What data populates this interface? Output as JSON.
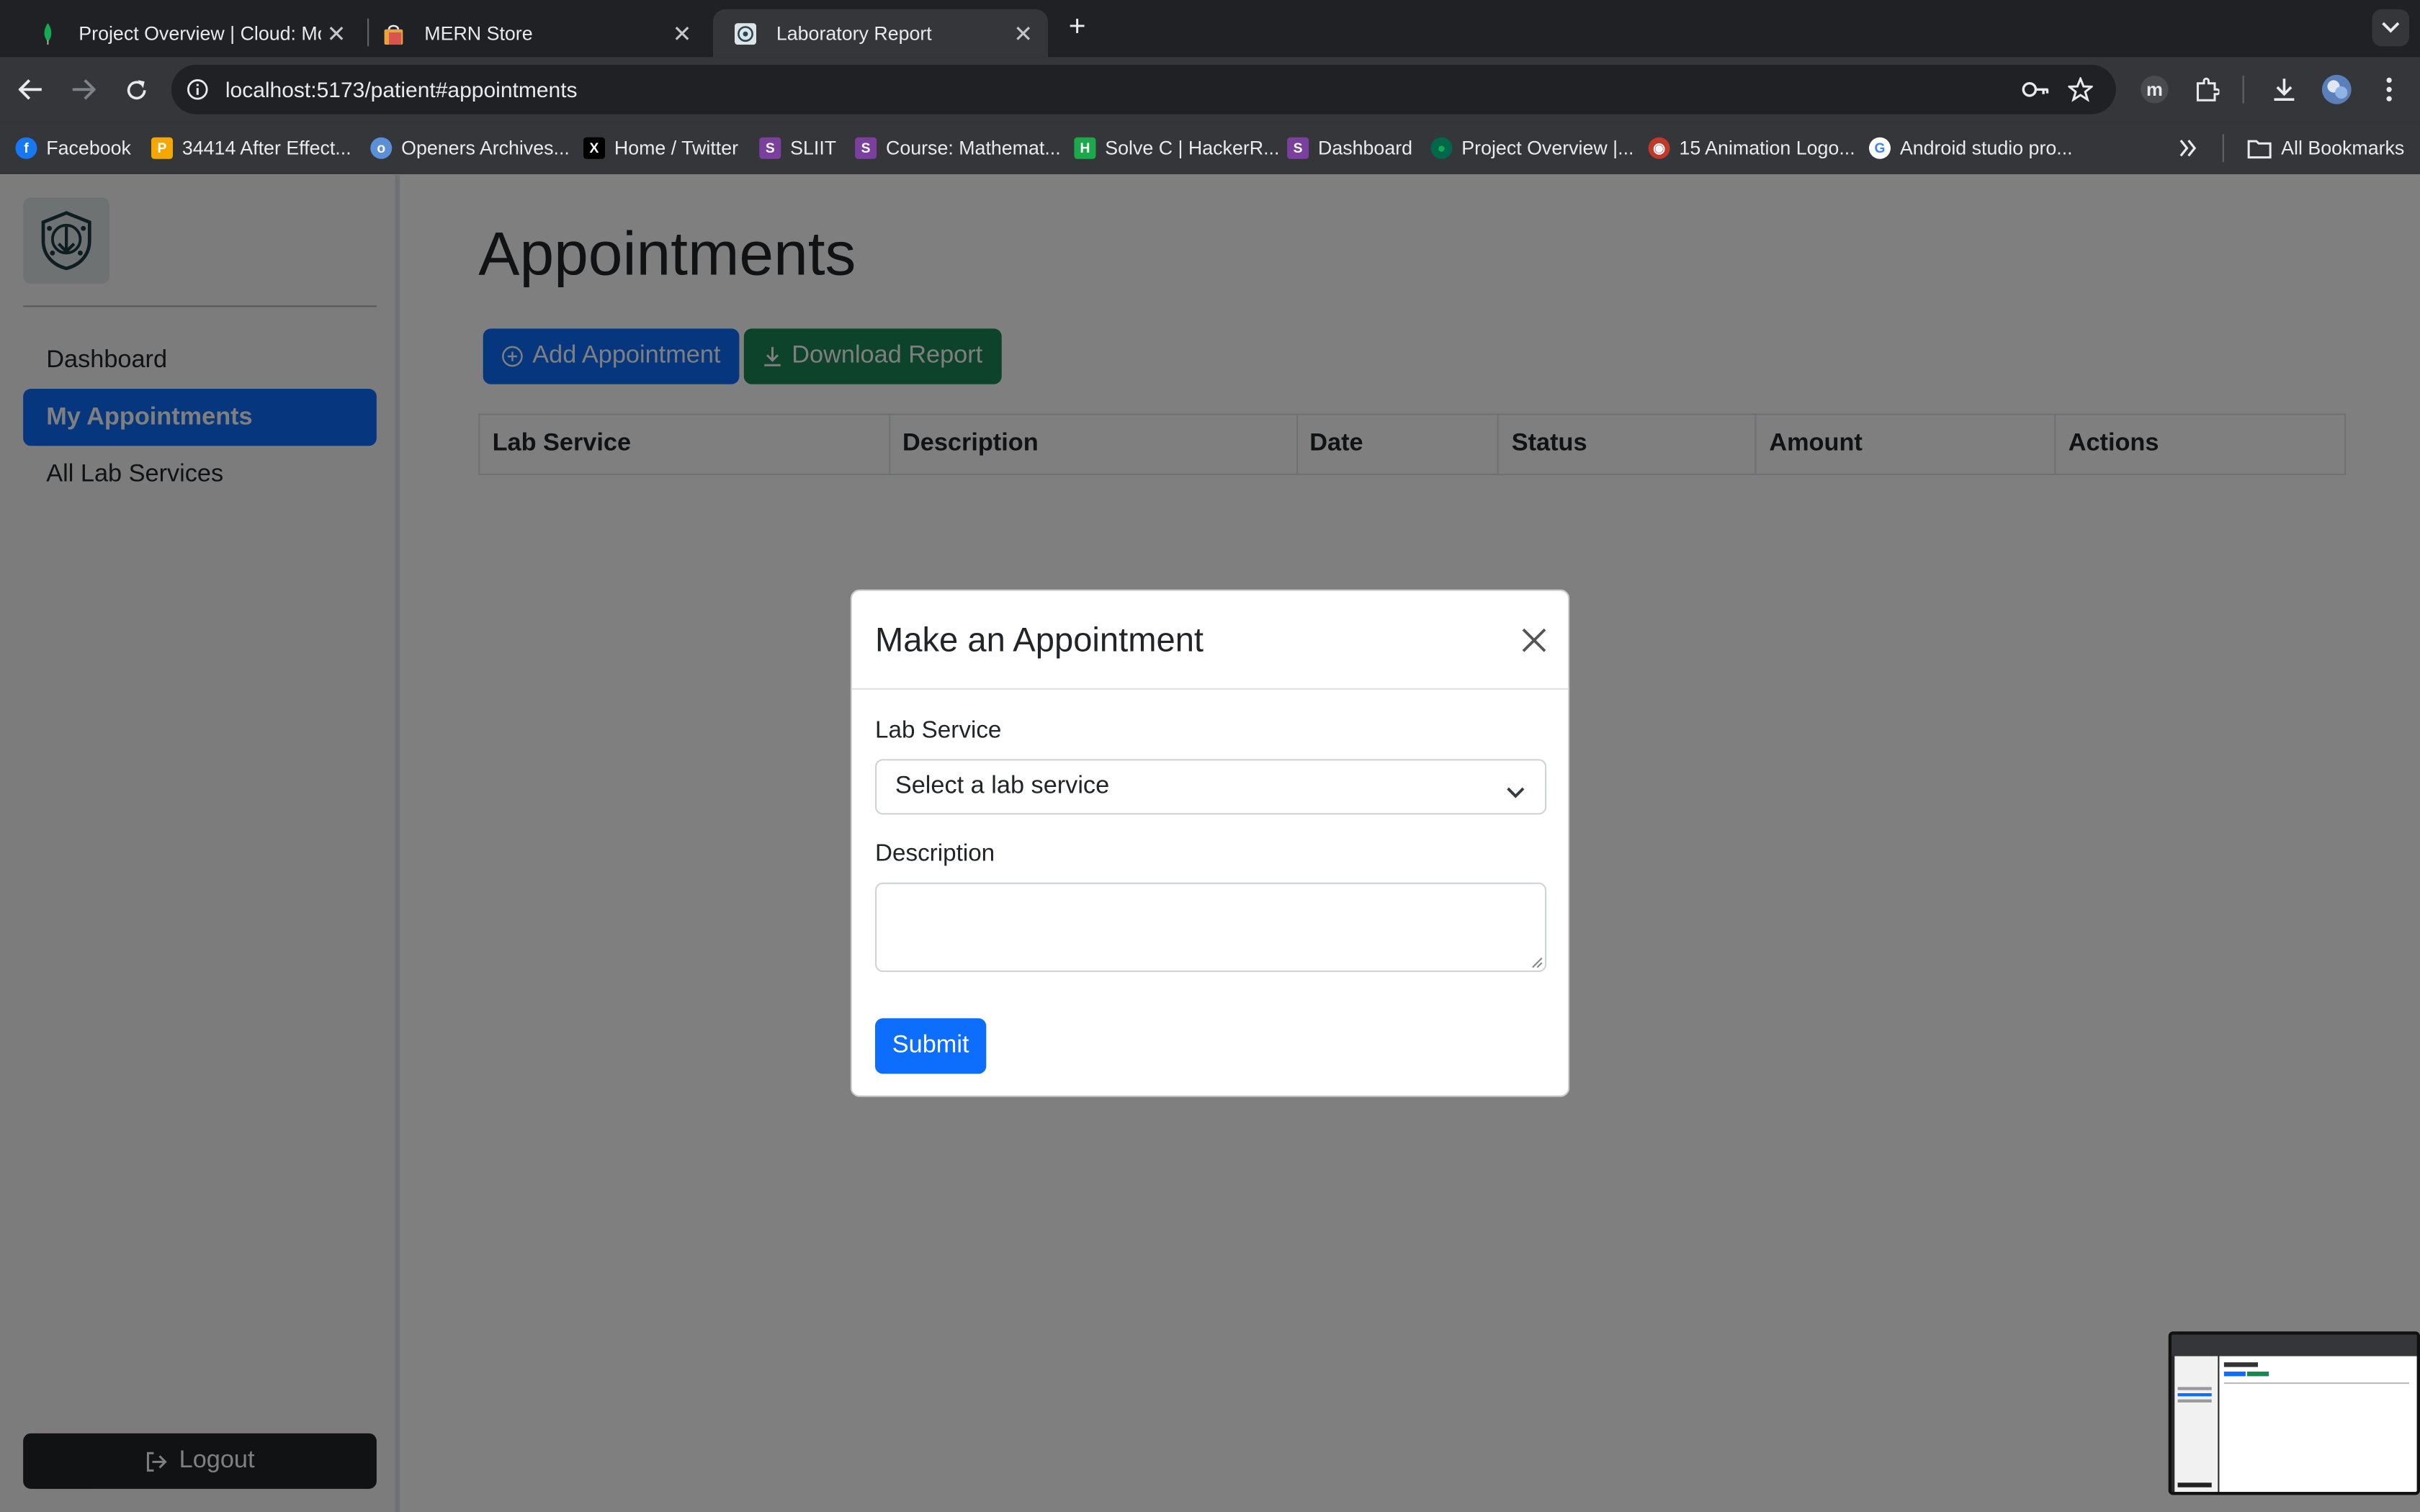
{
  "browser": {
    "tabs": [
      {
        "title": "Project Overview | Cloud: Mo",
        "icon": "mongodb-leaf-icon",
        "active": false
      },
      {
        "title": "MERN Store",
        "icon": "store-bag-icon",
        "active": false
      },
      {
        "title": "Laboratory Report",
        "icon": "lab-logo-icon",
        "active": true
      }
    ],
    "url": "localhost:5173/patient#appointments",
    "profile_letter": "m",
    "bookmarks": [
      {
        "label": "Facebook",
        "icon": "facebook-icon",
        "color": "#1877f2",
        "glyph": "f"
      },
      {
        "label": "34414 After Effect...",
        "icon": "p-icon",
        "color": "#f4a700",
        "glyph": "P"
      },
      {
        "label": "Openers Archives...",
        "icon": "openers-icon",
        "color": "#5b8fd6",
        "glyph": "o"
      },
      {
        "label": "Home / Twitter",
        "icon": "x-twitter-icon",
        "color": "#000000",
        "glyph": "X"
      },
      {
        "label": "SLIIT",
        "icon": "sliit-crest-icon",
        "color": "#7b3f9e",
        "glyph": "S"
      },
      {
        "label": "Course: Mathemat...",
        "icon": "sliit-crest-icon",
        "color": "#7b3f9e",
        "glyph": "S"
      },
      {
        "label": "Solve C | HackerR...",
        "icon": "hackerrank-icon",
        "color": "#1ba94c",
        "glyph": "H"
      },
      {
        "label": "Dashboard",
        "icon": "sliit-crest-icon",
        "color": "#7b3f9e",
        "glyph": "S"
      },
      {
        "label": "Project Overview |...",
        "icon": "mongodb-leaf-icon",
        "color": "#00684a",
        "glyph": "●"
      },
      {
        "label": "15 Animation Logo...",
        "icon": "animation-logo-icon",
        "color": "#c0392b",
        "glyph": "◉"
      },
      {
        "label": "Android studio pro...",
        "icon": "google-g-icon",
        "color": "#ffffff",
        "glyph": "G"
      }
    ],
    "all_bookmarks": "All Bookmarks"
  },
  "sidebar": {
    "items": [
      {
        "label": "Dashboard",
        "active": false
      },
      {
        "label": "My Appointments",
        "active": true
      },
      {
        "label": "All Lab Services",
        "active": false
      }
    ],
    "logout": "Logout"
  },
  "main": {
    "title": "Appointments",
    "add_button": "Add Appointment",
    "download_button": "Download Report",
    "table_headers": [
      "Lab Service",
      "Description",
      "Date",
      "Status",
      "Amount",
      "Actions"
    ]
  },
  "modal": {
    "title": "Make an Appointment",
    "lab_service_label": "Lab Service",
    "lab_service_placeholder": "Select a lab service",
    "description_label": "Description",
    "description_value": "",
    "submit": "Submit"
  },
  "colors": {
    "primary": "#0d6efd",
    "success": "#198754",
    "dark": "#212529"
  }
}
